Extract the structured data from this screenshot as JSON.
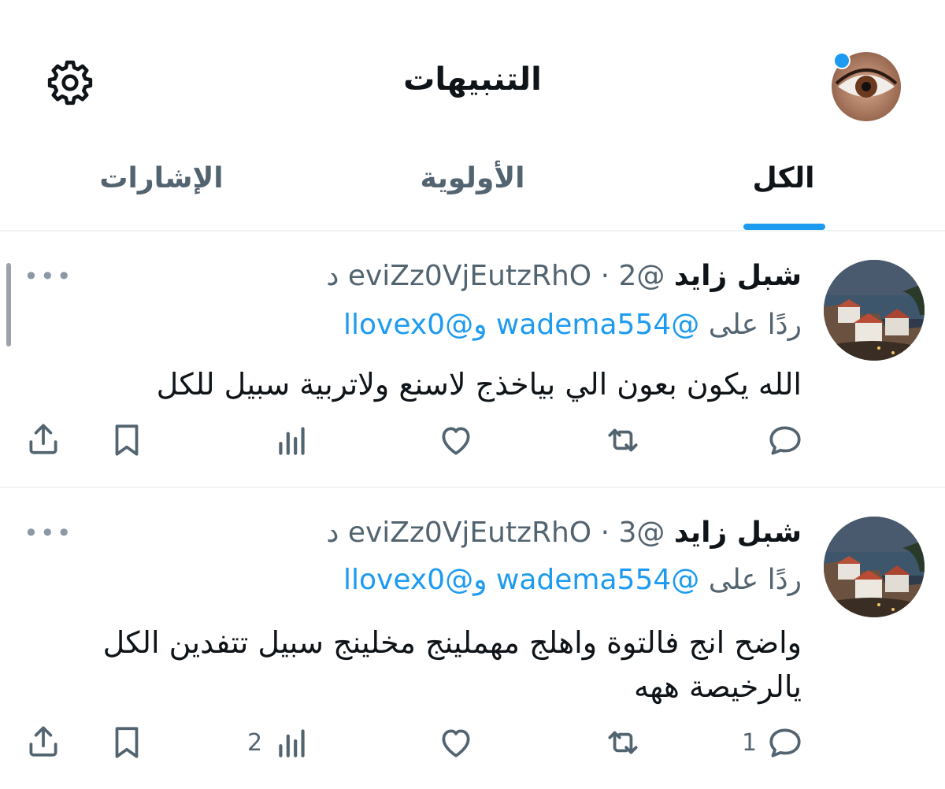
{
  "header": {
    "title": "التنبيهات",
    "settings_icon": "gear-icon",
    "avatar_icon": "profile-avatar"
  },
  "tabs": [
    {
      "label": "الكل",
      "active": true
    },
    {
      "label": "الأولوية",
      "active": false
    },
    {
      "label": "الإشارات",
      "active": false
    }
  ],
  "colors": {
    "accent": "#1d9bf0",
    "text": "#0f1419",
    "secondary": "#536471"
  },
  "tweets": [
    {
      "name": "شبل زايد",
      "handle": "@eviZz0VjEutzRhO",
      "separator": "·",
      "time": "2 د",
      "reply_prefix": "ردًا على",
      "mention1": "@wadema554",
      "conj": "و",
      "mention2": "@llovex0",
      "text": "الله يكون بعون الي بياخذج لاسنع ولاتربية سبيل للكل",
      "more": "•••",
      "reply_count": "",
      "retweet_count": "",
      "like_count": "",
      "views_count": ""
    },
    {
      "name": "شبل زايد",
      "handle": "@eviZz0VjEutzRhO",
      "separator": "·",
      "time": "3 د",
      "reply_prefix": "ردًا على",
      "mention1": "@wadema554",
      "conj": "و",
      "mention2": "@llovex0",
      "text": "واضح انج فالتوة واهلج مهملينج مخلينج سبيل تتفدين الكل يالرخيصة ههه",
      "more": "•••",
      "reply_count": "1",
      "retweet_count": "",
      "like_count": "",
      "views_count": "2"
    }
  ]
}
